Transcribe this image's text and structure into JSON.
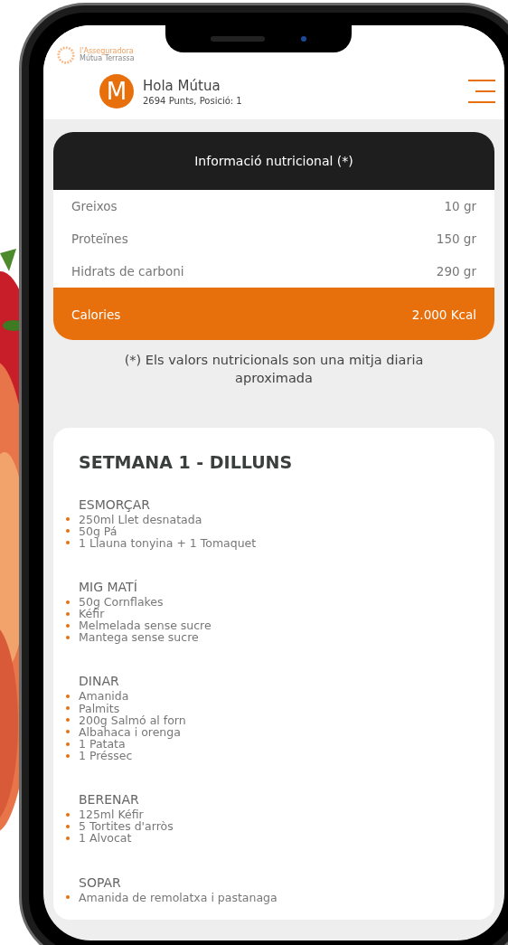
{
  "brand": {
    "line_1": "l'Asseguradora",
    "line_2": "Mútua Terrassa"
  },
  "user": {
    "initial": "M",
    "greeting": "Hola Mútua",
    "points": "2694 Punts, Posició: 1"
  },
  "nutrition": {
    "title": "Informació nutricional (*)",
    "rows": [
      {
        "label": "Greixos",
        "value": "10 gr",
        "kind": "plain"
      },
      {
        "label": "Proteïnes",
        "value": "150 gr",
        "kind": "plain"
      },
      {
        "label": "Hidrats de carboni",
        "value": "290 gr",
        "kind": "plain"
      },
      {
        "label": "Calories",
        "value": "2.000 Kcal",
        "kind": "total"
      }
    ],
    "note": "(*) Els valors nutricionals son una mitja diaria aproximada"
  },
  "menu": {
    "title": "SETMANA 1 - DILLUNS",
    "meals": [
      {
        "name": "ESMORÇAR",
        "items": [
          "250ml Llet desnatada",
          "50g Pá",
          "1 Llauna tonyina + 1 Tomaquet"
        ]
      },
      {
        "name": "MIG MATÍ",
        "items": [
          "50g Cornflakes",
          "Kéfir",
          "Melmelada sense sucre",
          "Mantega sense sucre"
        ]
      },
      {
        "name": "DINAR",
        "items": [
          "Amanida",
          "Palmits",
          "200g Salmó al forn",
          "Albahaca i orenga",
          "1 Patata",
          "1 Préssec"
        ]
      },
      {
        "name": "BERENAR",
        "items": [
          "125ml Kéfir",
          "5 Tortites d'arròs",
          "1 Alvocat"
        ]
      },
      {
        "name": "SOPAR",
        "items": [
          "Amanida de remolatxa i pastanaga"
        ]
      }
    ]
  }
}
